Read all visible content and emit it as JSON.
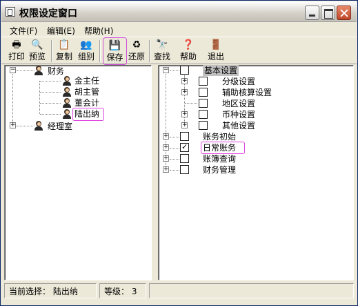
{
  "window": {
    "title": "权限设定窗口",
    "controls": {
      "minimize": "minimize-icon",
      "maximize": "maximize-icon",
      "close": "close-icon"
    }
  },
  "menu": [
    {
      "label": "文件(F)"
    },
    {
      "label": "编辑(E)"
    },
    {
      "label": "帮助(H)"
    }
  ],
  "toolbar": {
    "print": "打印",
    "preview": "预览",
    "copy": "复制",
    "group": "组别",
    "save": "保存",
    "restore": "还原",
    "find": "查找",
    "help": "帮助",
    "exit": "退出"
  },
  "left_tree": {
    "root": "财务",
    "members": [
      "金主任",
      "胡主管",
      "董会计",
      "陆出纳"
    ],
    "second_root": "经理室",
    "selected": "陆出纳"
  },
  "right_tree": {
    "root": "基本设置",
    "children": [
      {
        "label": "分级设置",
        "expandable": true,
        "checked": false
      },
      {
        "label": "辅助核算设置",
        "expandable": true,
        "checked": false
      },
      {
        "label": "地区设置",
        "expandable": false,
        "checked": false
      },
      {
        "label": "币种设置",
        "expandable": true,
        "checked": false
      },
      {
        "label": "其他设置",
        "expandable": true,
        "checked": false
      }
    ],
    "others": [
      {
        "label": "账务初始",
        "checked": false
      },
      {
        "label": "日常账务",
        "checked": true
      },
      {
        "label": "账簿查询",
        "checked": false
      },
      {
        "label": "财务管理",
        "checked": false
      }
    ]
  },
  "status": {
    "current_label": "当前选择：",
    "current_value": "陆出纳",
    "level_label": "等级：",
    "level_value": "3"
  },
  "colors": {
    "highlight": "#e040e0",
    "window_bg": "#ece9d8"
  }
}
